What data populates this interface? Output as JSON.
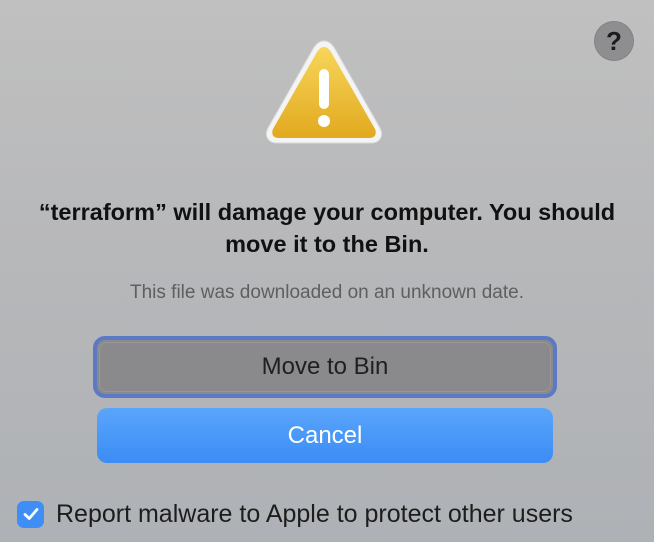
{
  "help": {
    "label": "?",
    "icon": "help-icon"
  },
  "alert": {
    "icon": "warning-icon",
    "icon_glyph": "!",
    "headline": "“terraform” will damage your computer. You should move it to the Bin.",
    "subtext": "This file was downloaded on an unknown date."
  },
  "buttons": {
    "move_to_bin": "Move to Bin",
    "cancel": "Cancel"
  },
  "report": {
    "label": "Report malware to Apple to protect other users",
    "checked": true
  },
  "colors": {
    "accent": "#3f8ef5",
    "focus_ring": "#5b79c4",
    "warning_yellow": "#f2c12e"
  }
}
